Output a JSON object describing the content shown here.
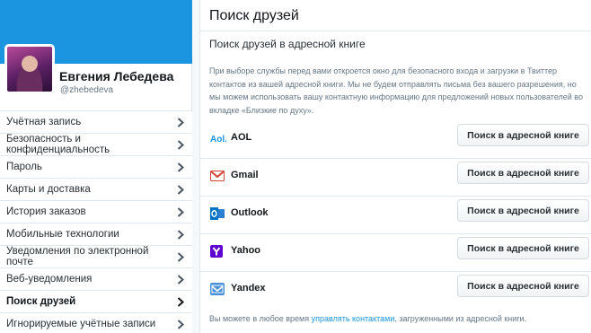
{
  "profile": {
    "name": "Евгения Лебедева",
    "handle": "@zhebedeva"
  },
  "colors": {
    "accent": "#1b95e0",
    "gmail_red": "#d44638",
    "outlook_blue": "#0072c6",
    "yahoo_purple": "#5f01d1",
    "yandex_blue": "#4a90d9"
  },
  "sidebar": {
    "items": [
      {
        "label": "Учётная запись",
        "icon": "chevron-right-icon"
      },
      {
        "label": "Безопасность и конфиденциальность",
        "icon": "chevron-right-icon"
      },
      {
        "label": "Пароль",
        "icon": "chevron-right-icon"
      },
      {
        "label": "Карты и доставка",
        "icon": "chevron-right-icon"
      },
      {
        "label": "История заказов",
        "icon": "chevron-right-icon"
      },
      {
        "label": "Мобильные технологии",
        "icon": "chevron-right-icon"
      },
      {
        "label": "Уведомления по электронной почте",
        "icon": "chevron-right-icon"
      },
      {
        "label": "Веб-уведомления",
        "icon": "chevron-right-icon"
      },
      {
        "label": "Поиск друзей",
        "icon": "chevron-right-icon",
        "active": true
      },
      {
        "label": "Игнорируемые учётные записи",
        "icon": "chevron-right-icon"
      }
    ]
  },
  "main": {
    "title": "Поиск друзей",
    "section_title": "Поиск друзей в адресной книге",
    "intro": "При выборе службы перед вами откроется окно для безопасного входа и загрузки в Твиттер контактов из вашей адресной книги. Мы не будем отправлять письма без вашего разрешения, но мы можем использовать вашу контактную информацию для предложений новых пользователей во вкладке «Близкие по духу».",
    "providers": [
      {
        "name": "AOL",
        "icon": "aol-icon",
        "button": "Поиск в адресной книге"
      },
      {
        "name": "Gmail",
        "icon": "gmail-icon",
        "button": "Поиск в адресной книге"
      },
      {
        "name": "Outlook",
        "icon": "outlook-icon",
        "button": "Поиск в адресной книге"
      },
      {
        "name": "Yahoo",
        "icon": "yahoo-icon",
        "button": "Поиск в адресной книге"
      },
      {
        "name": "Yandex",
        "icon": "yandex-icon",
        "button": "Поиск в адресной книге"
      }
    ],
    "footer": {
      "before": "Вы можете в любое время ",
      "link": "управлять контактами",
      "after": ", загруженными из адресной книги."
    }
  }
}
